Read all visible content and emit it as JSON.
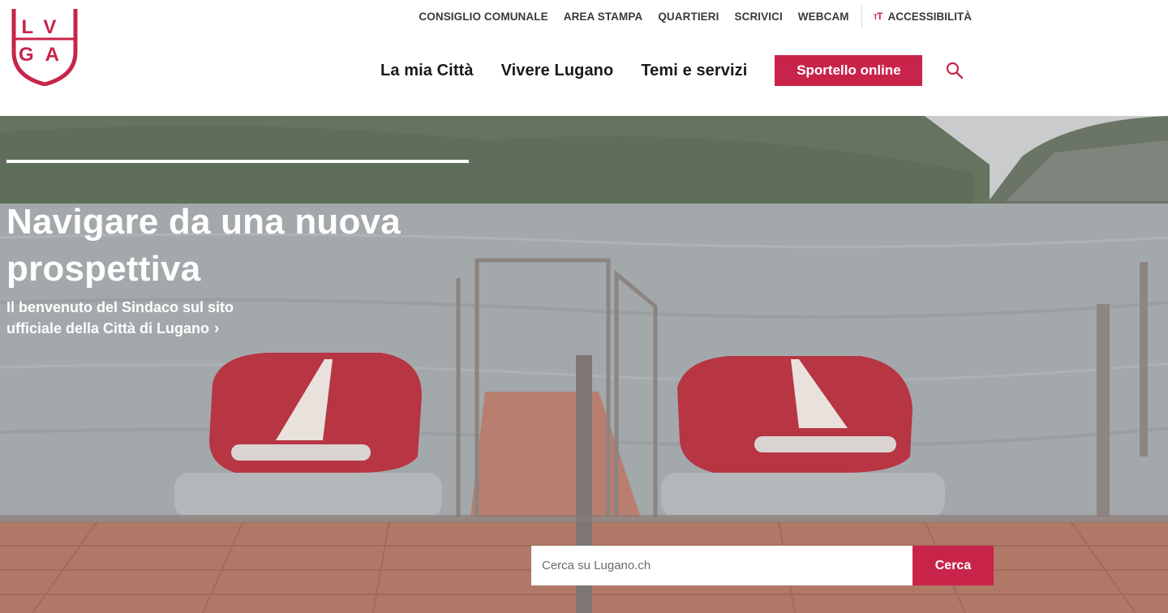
{
  "logo": {
    "line1": "LV",
    "line2": "GA",
    "icon": "lugano-shield-logo",
    "color": "#c8244a"
  },
  "utility_nav": {
    "items": [
      "CONSIGLIO COMUNALE",
      "AREA STAMPA",
      "QUARTIERI",
      "SCRIVICI",
      "WEBCAM"
    ],
    "accessibility_label": "ACCESSIBILITÀ",
    "accessibility_icon": "text-size-icon"
  },
  "main_nav": {
    "items": [
      "La mia Città",
      "Vivere Lugano",
      "Temi e servizi"
    ],
    "cta_label": "Sportello online",
    "search_icon": "search-icon"
  },
  "hero": {
    "title": "Navigare da una nuova prospettiva",
    "subtitle": "Il benvenuto del Sindaco sul sito ufficiale della Città di Lugano",
    "subtitle_icon": "chevron-right-icon"
  },
  "search": {
    "placeholder": "Cerca su Lugano.ch",
    "button_label": "Cerca"
  },
  "colors": {
    "brand": "#c8244a",
    "text": "#1a1a1a",
    "utility_text": "#3a3a3a"
  }
}
